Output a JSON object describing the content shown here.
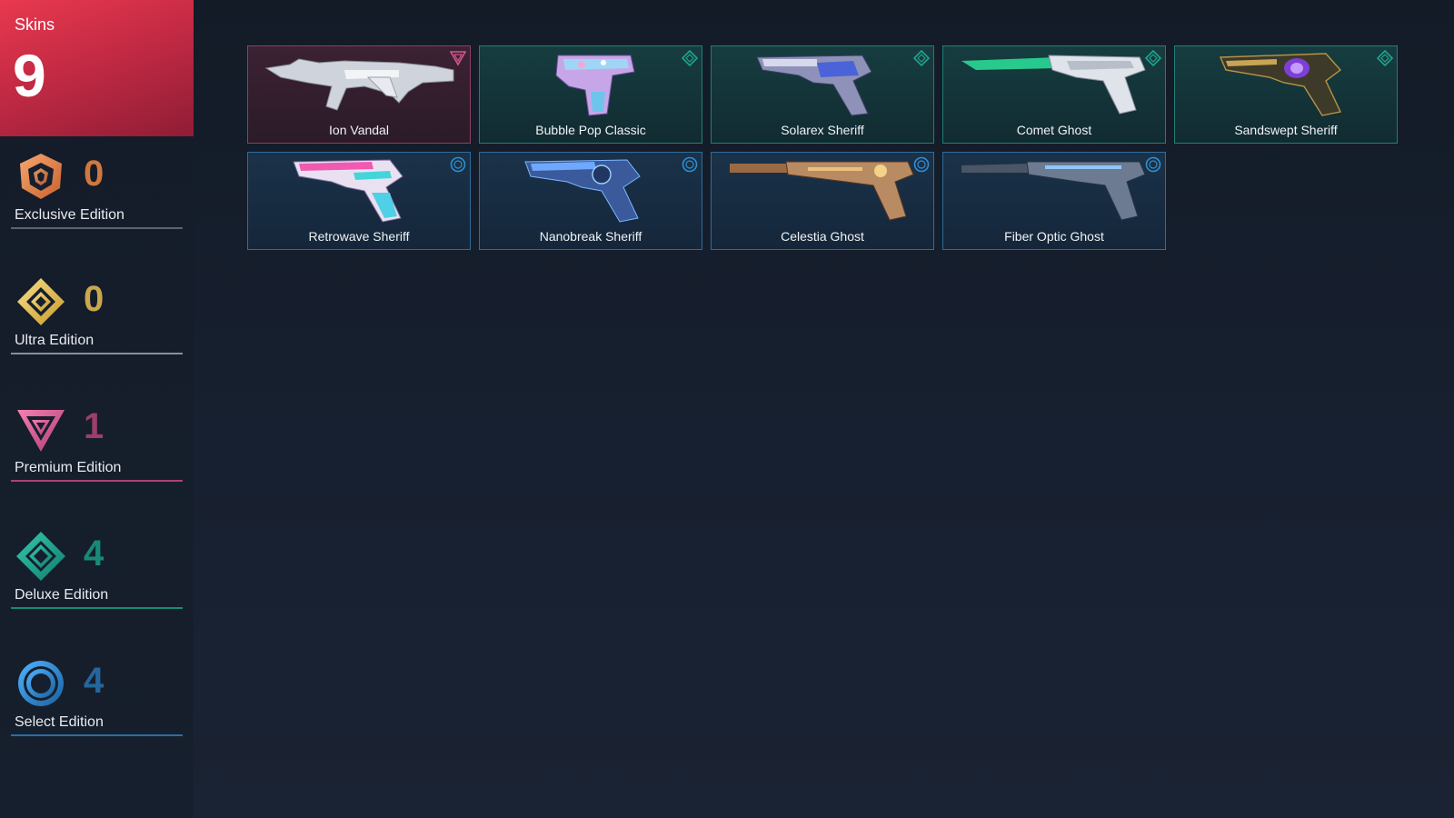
{
  "header": {
    "label": "Skins",
    "count": "9"
  },
  "editions": [
    {
      "name": "Exclusive Edition",
      "count": "0",
      "icon": "exclusive-edition-icon",
      "color": "#e58a4e"
    },
    {
      "name": "Ultra Edition",
      "count": "0",
      "icon": "ultra-edition-icon",
      "color": "#e6c45a"
    },
    {
      "name": "Premium Edition",
      "count": "1",
      "icon": "premium-edition-icon",
      "color": "#d2578f"
    },
    {
      "name": "Deluxe Edition",
      "count": "4",
      "icon": "deluxe-edition-icon",
      "color": "#1fa58f"
    },
    {
      "name": "Select Edition",
      "count": "4",
      "icon": "select-edition-icon",
      "color": "#2f8fd1"
    }
  ],
  "skins": [
    {
      "name": "Ion Vandal",
      "tier": "premium"
    },
    {
      "name": "Bubble Pop Classic",
      "tier": "deluxe"
    },
    {
      "name": "Solarex Sheriff",
      "tier": "deluxe"
    },
    {
      "name": "Comet Ghost",
      "tier": "deluxe"
    },
    {
      "name": "Sandswept Sheriff",
      "tier": "deluxe"
    },
    {
      "name": "Retrowave Sheriff",
      "tier": "select"
    },
    {
      "name": "Nanobreak Sheriff",
      "tier": "select"
    },
    {
      "name": "Celestia Ghost",
      "tier": "select"
    },
    {
      "name": "Fiber Optic Ghost",
      "tier": "select"
    }
  ]
}
